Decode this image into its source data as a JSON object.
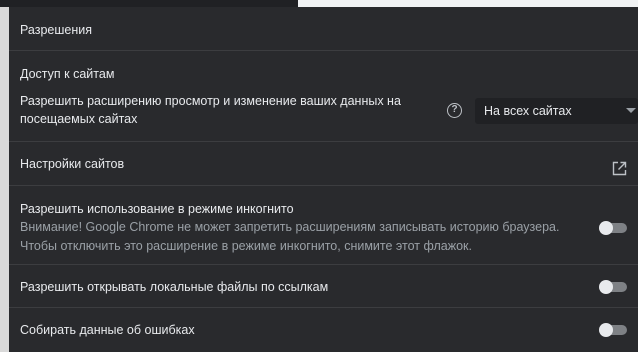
{
  "permissions": {
    "title": "Разрешения",
    "site_access": {
      "heading": "Доступ к сайтам",
      "description": "Разрешить расширению просмотр и изменение ваших данных на посещаемых сайтах",
      "selected_option": "На всех сайтах"
    },
    "site_settings": {
      "label": "Настройки сайтов"
    },
    "incognito": {
      "label": "Разрешить использование в режиме инкогнито",
      "warning": "Внимание! Google Chrome не может запретить расширениям записывать историю браузера. Чтобы отключить это расширение в режиме инкогнито, снимите этот флажок.",
      "enabled": false
    },
    "file_urls": {
      "label": "Разрешить открывать локальные файлы по ссылкам",
      "enabled": false
    },
    "error_collection": {
      "label": "Собирать данные об ошибках",
      "enabled": false
    }
  }
}
